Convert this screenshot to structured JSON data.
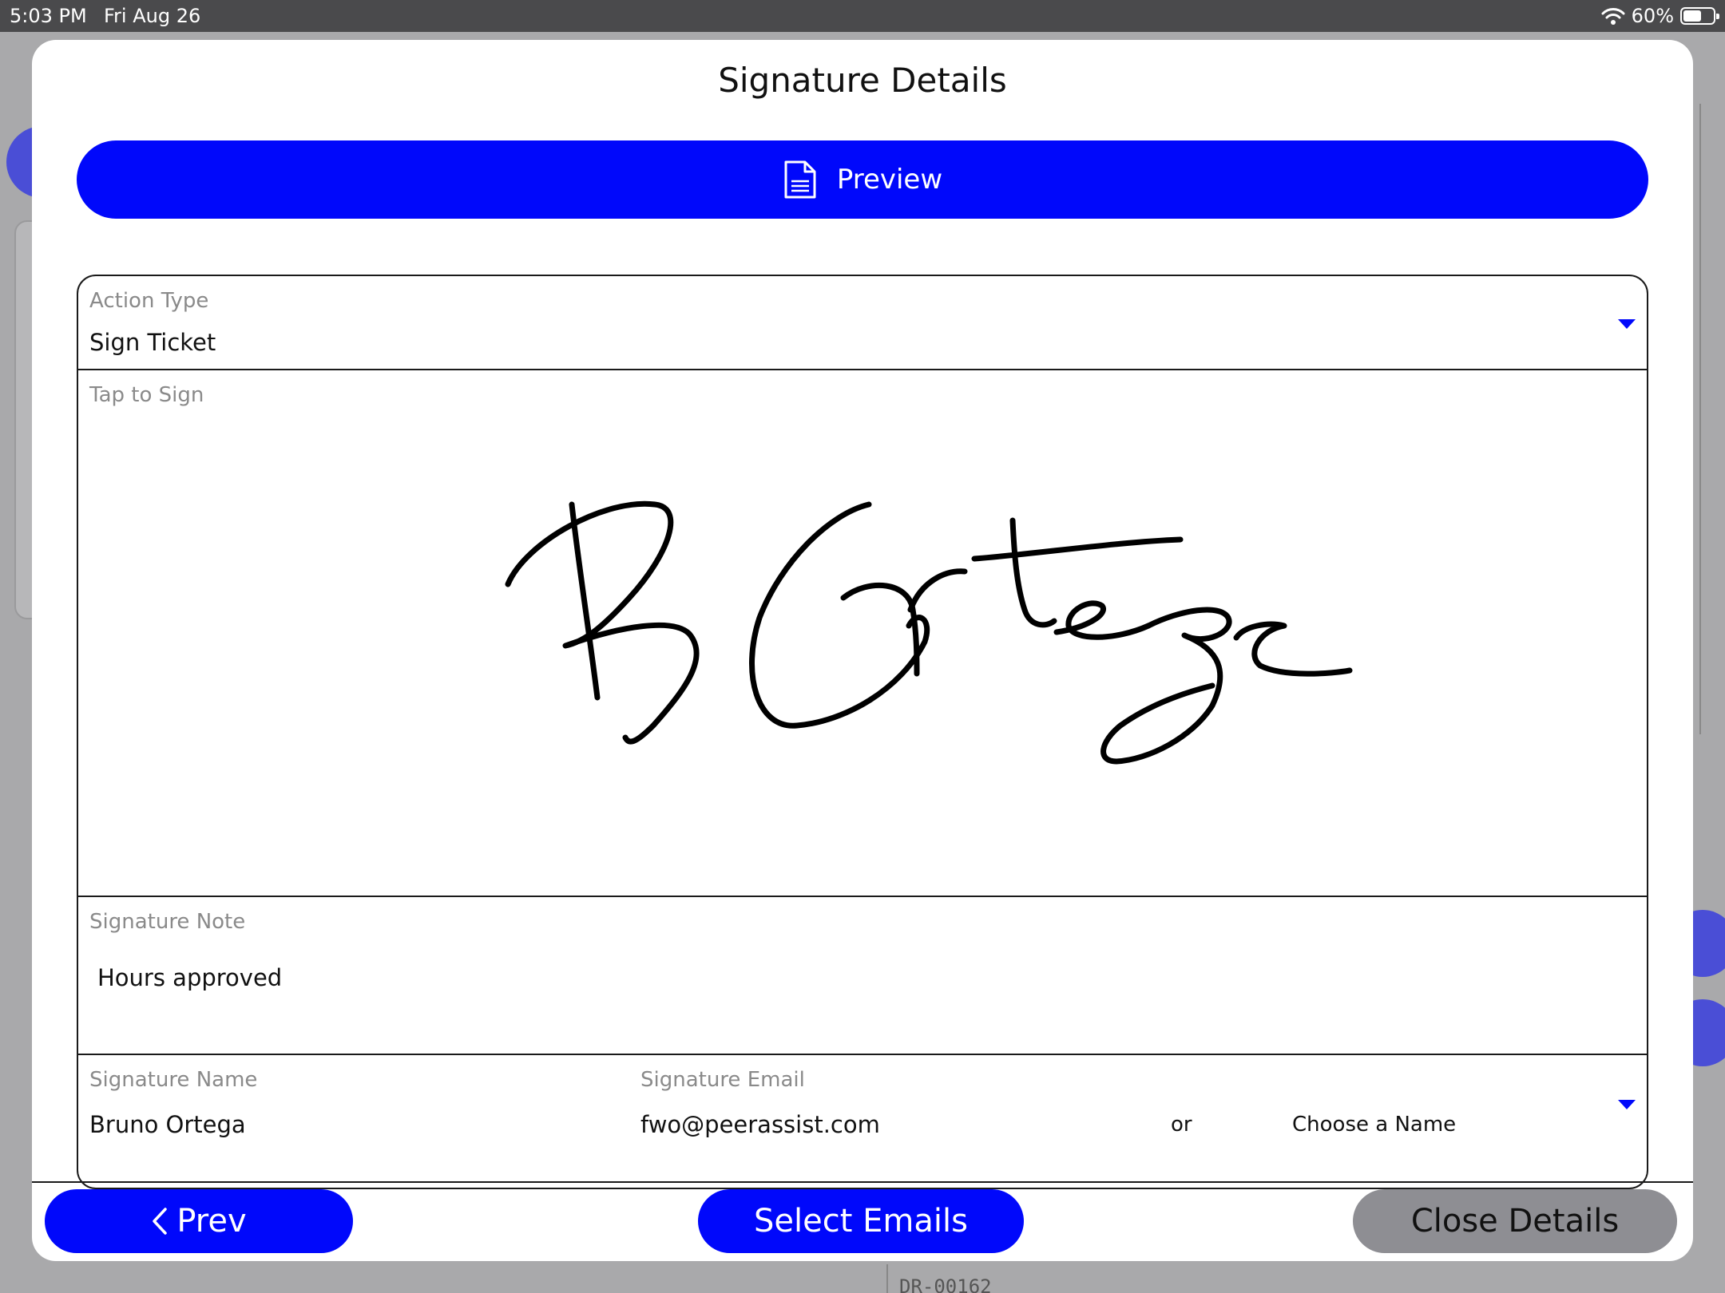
{
  "status_bar": {
    "time": "5:03 PM",
    "date": "Fri Aug 26",
    "battery": "60%",
    "battery_level": 0.6
  },
  "background": {
    "ticket_text": "DR-00162"
  },
  "modal": {
    "title": "Signature Details",
    "preview_label": "Preview",
    "action_type": {
      "label": "Action Type",
      "value": "Sign Ticket"
    },
    "signature_pad": {
      "label": "Tap to Sign"
    },
    "signature_note": {
      "label": "Signature Note",
      "value": "Hours approved"
    },
    "signature_name": {
      "label": "Signature Name",
      "value": "Bruno Ortega"
    },
    "signature_email": {
      "label": "Signature Email",
      "value": "fwo@peerassist.com"
    },
    "or_text": "or",
    "choose_name_placeholder": "Choose a Name"
  },
  "footer": {
    "prev_label": "Prev",
    "select_emails_label": "Select Emails",
    "close_details_label": "Close Details"
  },
  "colors": {
    "accent": "#0008fb",
    "close_button": "#8e8e93",
    "overlay": "#a9a9ab",
    "status_bar": "#4a4a4c"
  }
}
